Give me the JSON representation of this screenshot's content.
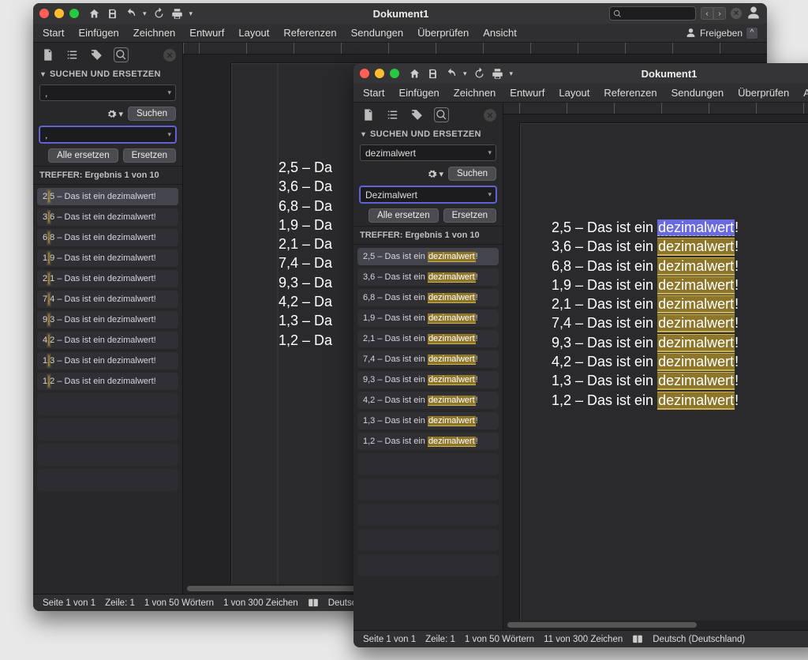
{
  "doc_title": "Dokument1",
  "ribbon_tabs": [
    "Start",
    "Einfügen",
    "Zeichnen",
    "Entwurf",
    "Layout",
    "Referenzen",
    "Sendungen",
    "Überprüfen",
    "Ansicht"
  ],
  "share_label": "Freigeben",
  "panel_title": "SUCHEN UND ERSETZEN",
  "search_btn": "Suchen",
  "replace_all_btn": "Alle ersetzen",
  "replace_btn": "Ersetzen",
  "hits_header": "TREFFER: Ergebnis 1 von 10",
  "back": {
    "search_value": ",",
    "replace_value": ",",
    "status": {
      "page": "Seite 1 von 1",
      "line": "Zeile: 1",
      "words": "1 von 50 Wörtern",
      "chars": "1 von 300 Zeichen",
      "lang": "Deutsch"
    },
    "doc_lines": [
      "2,5 – Da",
      "3,6 – Da",
      "6,8 – Da",
      "1,9 – Da",
      "2,1 – Da",
      "7,4 – Da",
      "9,3 – Da",
      "4,2 – Da",
      "1,3 – Da",
      "1,2 – Da"
    ],
    "hits": [
      {
        "num": "2,5",
        "rest": " – Das ist ein dezimalwert!"
      },
      {
        "num": "3,6",
        "rest": " – Das ist ein dezimalwert!"
      },
      {
        "num": "6,8",
        "rest": " – Das ist ein dezimalwert!"
      },
      {
        "num": "1,9",
        "rest": " – Das ist ein dezimalwert!"
      },
      {
        "num": "2,1",
        "rest": " – Das ist ein dezimalwert!"
      },
      {
        "num": "7,4",
        "rest": " – Das ist ein dezimalwert!"
      },
      {
        "num": "9,3",
        "rest": " – Das ist ein dezimalwert!"
      },
      {
        "num": "4,2",
        "rest": " – Das ist ein dezimalwert!"
      },
      {
        "num": "1,3",
        "rest": " – Das ist ein dezimalwert!"
      },
      {
        "num": "1,2",
        "rest": " – Das ist ein dezimalwert!"
      }
    ]
  },
  "front": {
    "search_value": "dezimalwert",
    "replace_value": "Dezimalwert",
    "status": {
      "page": "Seite 1 von 1",
      "line": "Zeile: 1",
      "words": "1 von 50 Wörtern",
      "chars": "11 von 300 Zeichen",
      "lang": "Deutsch (Deutschland)"
    },
    "doc_lines": [
      {
        "pre": "2,5 – Das ist ein ",
        "hl": "dezimalwert",
        "post": "!",
        "sel": true
      },
      {
        "pre": "3,6 – Das ist ein ",
        "hl": "dezimalwert",
        "post": "!"
      },
      {
        "pre": "6,8 – Das ist ein ",
        "hl": "dezimalwert",
        "post": "!"
      },
      {
        "pre": "1,9 – Das ist ein ",
        "hl": "dezimalwert",
        "post": "!"
      },
      {
        "pre": "2,1 – Das ist ein ",
        "hl": "dezimalwert",
        "post": "!"
      },
      {
        "pre": "7,4 – Das ist ein ",
        "hl": "dezimalwert",
        "post": "!"
      },
      {
        "pre": "9,3 – Das ist ein ",
        "hl": "dezimalwert",
        "post": "!"
      },
      {
        "pre": "4,2 – Das ist ein ",
        "hl": "dezimalwert",
        "post": "!"
      },
      {
        "pre": "1,3 – Das ist ein ",
        "hl": "dezimalwert",
        "post": "!"
      },
      {
        "pre": "1,2 – Das ist ein ",
        "hl": "dezimalwert",
        "post": "!"
      }
    ],
    "hits": [
      {
        "pre": "2,5 – Das ist ein ",
        "hl": "dezimalwert",
        "post": "!"
      },
      {
        "pre": "3,6 – Das ist ein ",
        "hl": "dezimalwert",
        "post": "!"
      },
      {
        "pre": "6,8 – Das ist ein ",
        "hl": "dezimalwert",
        "post": "!"
      },
      {
        "pre": "1,9 – Das ist ein ",
        "hl": "dezimalwert",
        "post": "!"
      },
      {
        "pre": "2,1 – Das ist ein ",
        "hl": "dezimalwert",
        "post": "!"
      },
      {
        "pre": "7,4 – Das ist ein ",
        "hl": "dezimalwert",
        "post": "!"
      },
      {
        "pre": "9,3 – Das ist ein ",
        "hl": "dezimalwert",
        "post": "!"
      },
      {
        "pre": "4,2 – Das ist ein ",
        "hl": "dezimalwert",
        "post": "!"
      },
      {
        "pre": "1,3 – Das ist ein ",
        "hl": "dezimalwert",
        "post": "!"
      },
      {
        "pre": "1,2 – Das ist ein ",
        "hl": "dezimalwert",
        "post": "!"
      }
    ]
  },
  "searchbox_placeholder": ""
}
